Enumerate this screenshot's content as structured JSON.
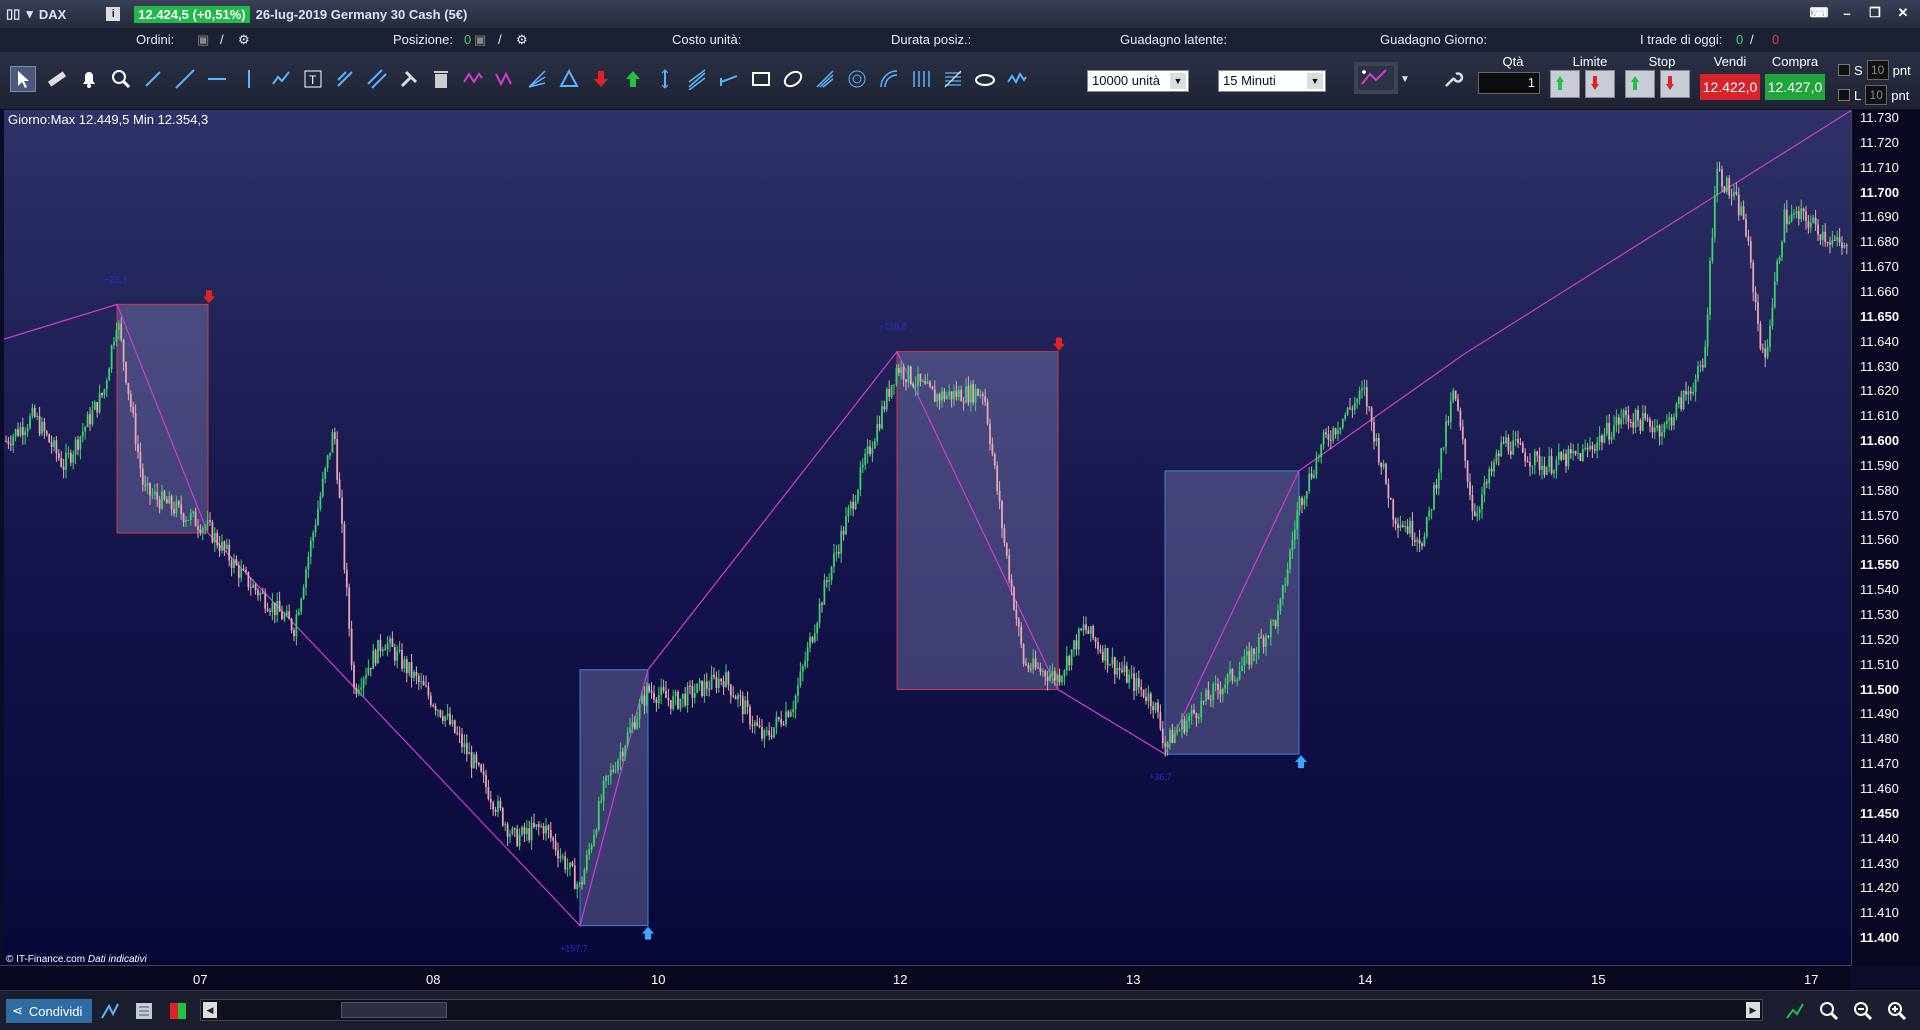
{
  "titlebar": {
    "symbol": "DAX",
    "info_icon": "i",
    "price_badge": "12.424,5 (+0,51%)",
    "title": "26-lug-2019 Germany 30 Cash (5€)"
  },
  "infobar": {
    "ordini": "Ordini:",
    "ordini_sep": "/",
    "posizione": "Posizione:",
    "posizione_val": "0",
    "posizione_sep": "/",
    "costo": "Costo unità:",
    "durata": "Durata posiz.:",
    "guadagno_latente": "Guadagno latente:",
    "guadagno_giorno": "Guadagno Giorno:",
    "trade_oggi": "I trade di oggi:",
    "trade_oggi_green": "0",
    "trade_oggi_sep": "/",
    "trade_oggi_red": "0"
  },
  "toolbar": {
    "units_select": "10000 unità",
    "timeframe_select": "15 Minuti",
    "qta_label": "Qtà",
    "qta_value": "1",
    "limite_label": "Limite",
    "stop_label": "Stop",
    "vendi_label": "Vendi",
    "vendi_price": "12.422,0",
    "compra_label": "Compra",
    "compra_price": "12.427,0",
    "s_label": "S",
    "l_label": "L",
    "s_value": "10",
    "l_value": "10",
    "pnt": "pnt"
  },
  "chart": {
    "minmax": "Giorno:Max 12.449,5 Min 12.354,3",
    "copyright": "© IT-Finance.com",
    "copyright_note": "Dati indicativi",
    "box_labels": [
      "+23,3",
      "+157,7",
      "+128,8",
      "+36,7"
    ]
  },
  "price_axis": [
    {
      "v": "11.730",
      "bold": false
    },
    {
      "v": "11.720",
      "bold": false
    },
    {
      "v": "11.710",
      "bold": false
    },
    {
      "v": "11.700",
      "bold": true
    },
    {
      "v": "11.690",
      "bold": false
    },
    {
      "v": "11.680",
      "bold": false
    },
    {
      "v": "11.670",
      "bold": false
    },
    {
      "v": "11.660",
      "bold": false
    },
    {
      "v": "11.650",
      "bold": true
    },
    {
      "v": "11.640",
      "bold": false
    },
    {
      "v": "11.630",
      "bold": false
    },
    {
      "v": "11.620",
      "bold": false
    },
    {
      "v": "11.610",
      "bold": false
    },
    {
      "v": "11.600",
      "bold": true
    },
    {
      "v": "11.590",
      "bold": false
    },
    {
      "v": "11.580",
      "bold": false
    },
    {
      "v": "11.570",
      "bold": false
    },
    {
      "v": "11.560",
      "bold": false
    },
    {
      "v": "11.550",
      "bold": true
    },
    {
      "v": "11.540",
      "bold": false
    },
    {
      "v": "11.530",
      "bold": false
    },
    {
      "v": "11.520",
      "bold": false
    },
    {
      "v": "11.510",
      "bold": false
    },
    {
      "v": "11.500",
      "bold": true
    },
    {
      "v": "11.490",
      "bold": false
    },
    {
      "v": "11.480",
      "bold": false
    },
    {
      "v": "11.470",
      "bold": false
    },
    {
      "v": "11.460",
      "bold": false
    },
    {
      "v": "11.450",
      "bold": true
    },
    {
      "v": "11.440",
      "bold": false
    },
    {
      "v": "11.430",
      "bold": false
    },
    {
      "v": "11.420",
      "bold": false
    },
    {
      "v": "11.410",
      "bold": false
    },
    {
      "v": "11.400",
      "bold": true
    }
  ],
  "time_axis": [
    "07",
    "08",
    "10",
    "12",
    "13",
    "14",
    "15",
    "17"
  ],
  "bottombar": {
    "share": "Condividi"
  },
  "colors": {
    "up": "#3ed26a",
    "down": "#e8a7b4",
    "zigzag": "#d13bd6",
    "box_red": "#d13a44",
    "box_blue": "#3a86d6"
  }
}
